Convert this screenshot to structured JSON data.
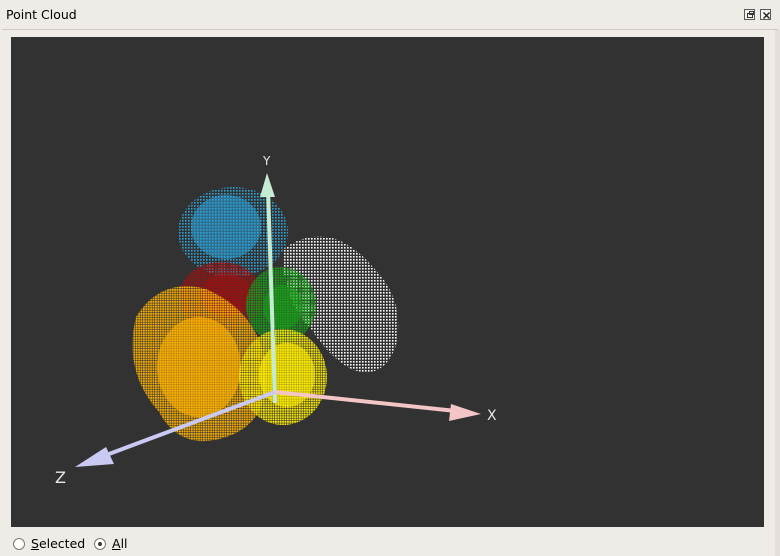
{
  "panel": {
    "title": "Point Cloud",
    "float_icon": "restore-icon",
    "close_icon": "close-icon"
  },
  "viewport": {
    "background_color": "#323232",
    "axes": {
      "x": {
        "label": "X",
        "color": "#f4c5c5"
      },
      "y": {
        "label": "Y",
        "color": "#c5ecd2"
      },
      "z": {
        "label": "Z",
        "color": "#c9c9f3"
      }
    },
    "clusters": [
      {
        "color": "#2ea3d9"
      },
      {
        "color": "#ffffff"
      },
      {
        "color": "#a01010"
      },
      {
        "color": "#19a019"
      },
      {
        "color": "#ffb300"
      },
      {
        "color": "#ffee00"
      }
    ]
  },
  "display_mode": {
    "options": [
      {
        "prefix": "",
        "underlined": "S",
        "rest": "elected",
        "selected": false
      },
      {
        "prefix": "",
        "underlined": "A",
        "rest": "ll",
        "selected": true
      }
    ]
  }
}
